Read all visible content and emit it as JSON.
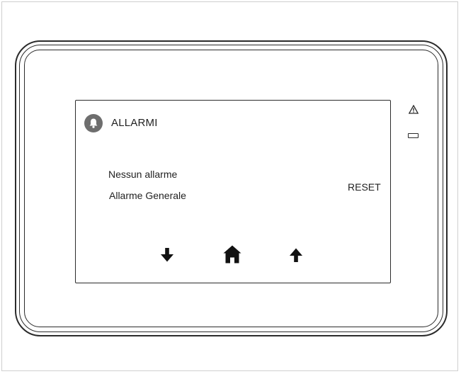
{
  "screen": {
    "title": "ALLARMI",
    "alarm_status": "Nessun allarme",
    "alarm_type": "Allarme Generale",
    "reset_label": "RESET"
  },
  "icons": {
    "header": "bell-icon",
    "nav_down": "arrow-down-icon",
    "nav_home": "home-icon",
    "nav_up": "arrow-up-icon",
    "device_warning": "warning-icon",
    "device_led": "status-led"
  },
  "colors": {
    "bezel": "#2b2b2b",
    "icon_circle": "#6e6e6e",
    "text": "#222222"
  }
}
